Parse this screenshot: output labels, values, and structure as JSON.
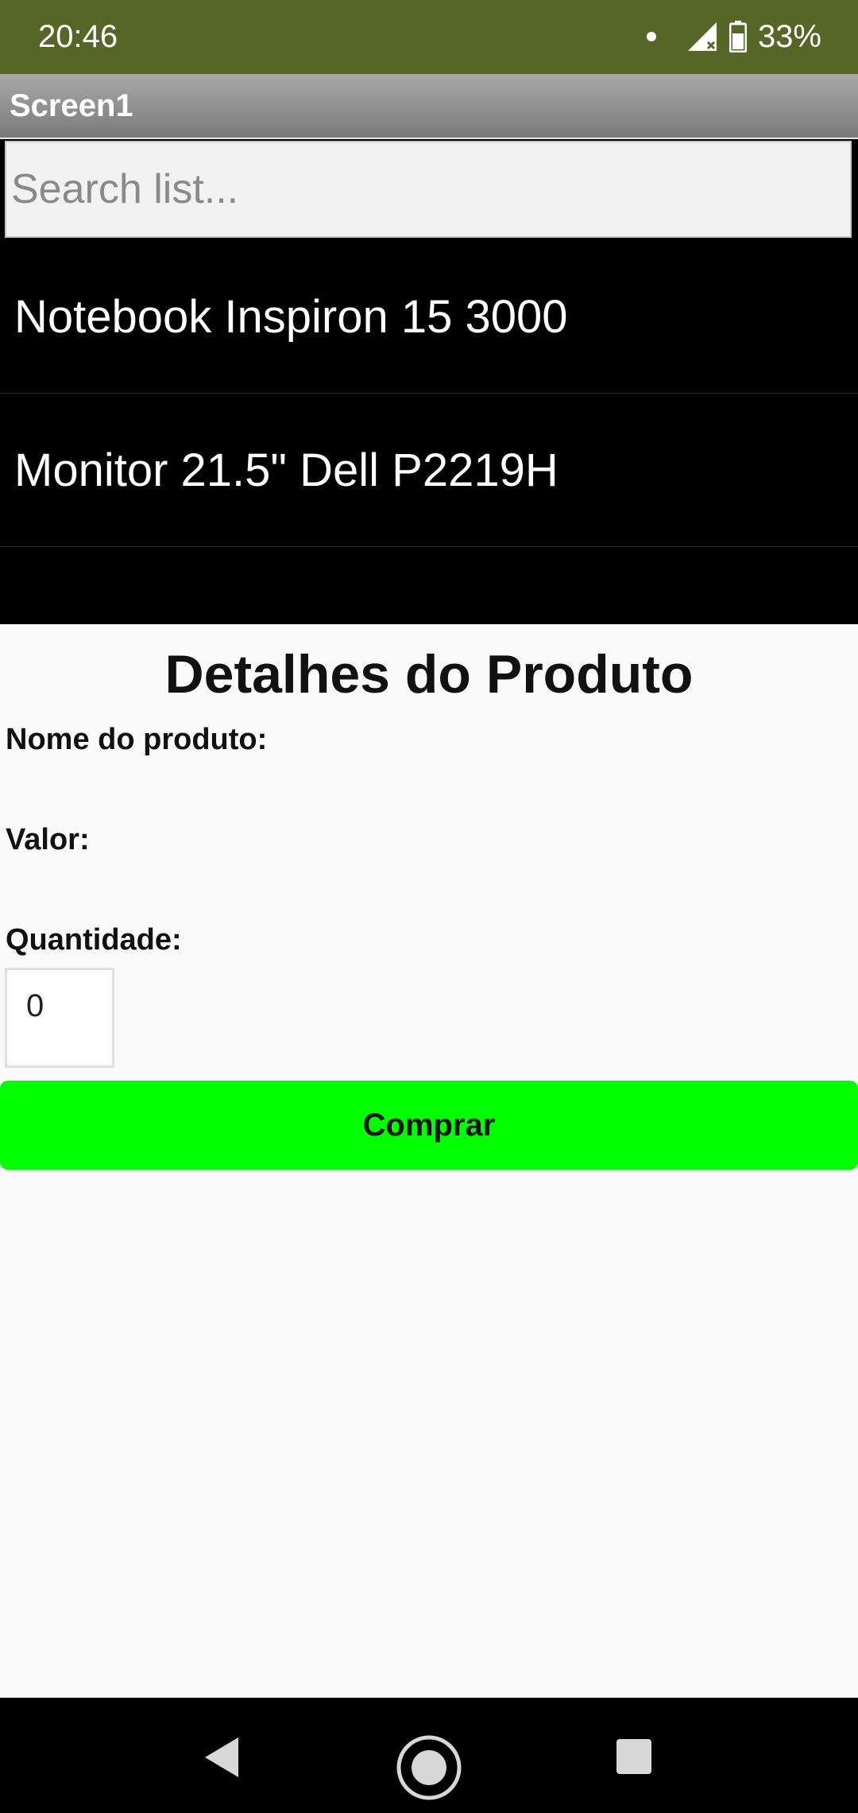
{
  "status_bar": {
    "time": "20:46",
    "battery": "33%"
  },
  "app": {
    "title": "Screen1"
  },
  "search": {
    "placeholder": "Search list..."
  },
  "list": {
    "items": [
      {
        "label": "Notebook Inspiron 15 3000"
      },
      {
        "label": "Monitor 21.5\" Dell P2219H"
      }
    ]
  },
  "details": {
    "title": "Detalhes do Produto",
    "name_label": "Nome do produto:",
    "value_label": "Valor:",
    "quantity_label": "Quantidade:",
    "quantity_value": "0",
    "buy_label": "Comprar"
  },
  "colors": {
    "status_bar": "#556627",
    "buy_button": "#00ff00"
  }
}
